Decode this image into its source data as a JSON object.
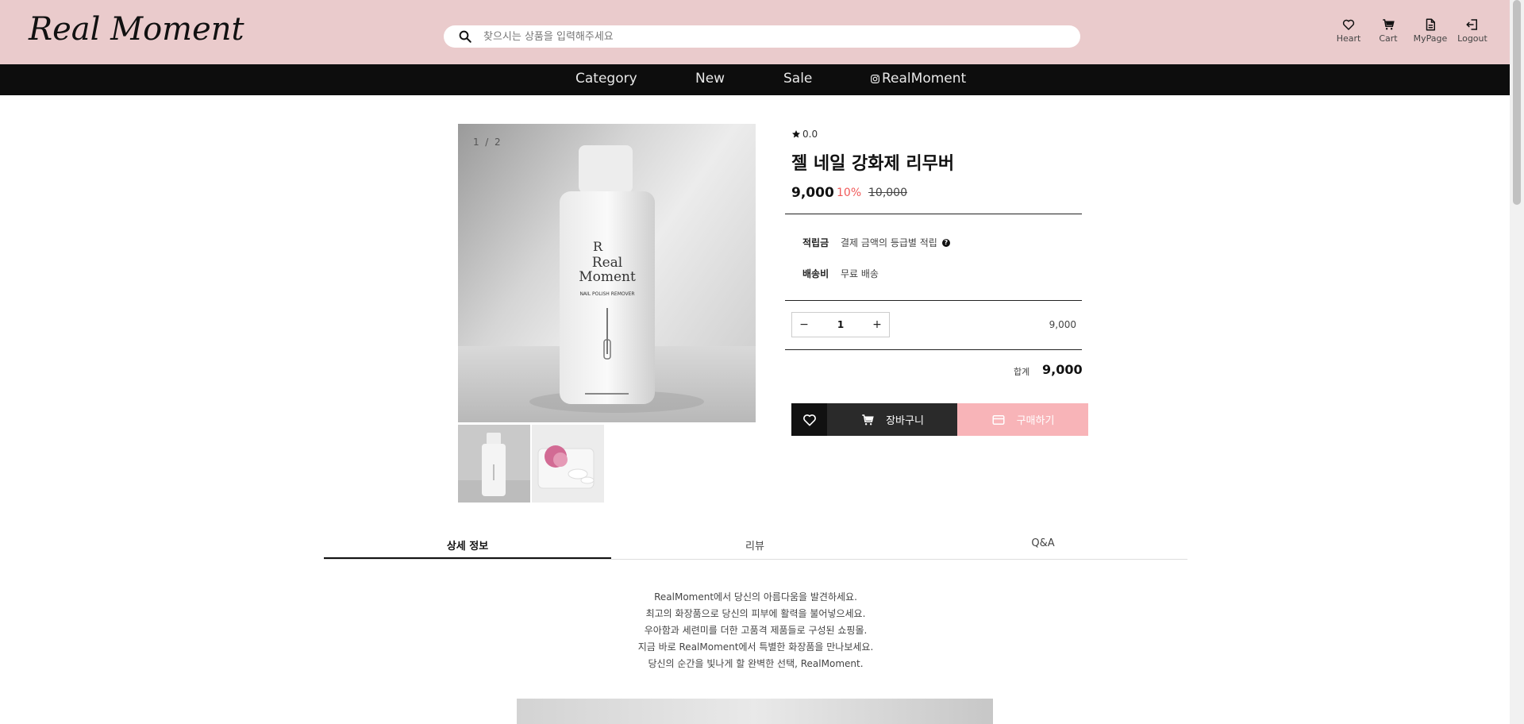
{
  "brand": {
    "logo": "Real Moment"
  },
  "search": {
    "placeholder": "찾으시는 상품을 입력해주세요"
  },
  "utility": [
    {
      "label": "Heart",
      "icon": "heart-icon"
    },
    {
      "label": "Cart",
      "icon": "cart-icon"
    },
    {
      "label": "MyPage",
      "icon": "document-icon"
    },
    {
      "label": "Logout",
      "icon": "logout-icon"
    }
  ],
  "nav": [
    {
      "label": "Category"
    },
    {
      "label": "New"
    },
    {
      "label": "Sale"
    },
    {
      "label": "RealMoment",
      "icon": "instagram-icon"
    }
  ],
  "gallery": {
    "counter_current": "1",
    "counter_sep": "/",
    "counter_total": "2"
  },
  "product": {
    "rating": "0.0",
    "title": "젤 네일 강화제 리무버",
    "price": "9,000",
    "discount": "10%",
    "original_price": "10,000",
    "points_label": "적립금",
    "points_value": "결제 금액의 등급별 적립",
    "shipping_label": "배송비",
    "shipping_value": "무료 배송",
    "quantity": "1",
    "line_total": "9,000",
    "sum_label": "합계",
    "sum_value": "9,000",
    "cart_label": "장바구니",
    "buy_label": "구매하기"
  },
  "tabs": [
    {
      "label": "상세 정보"
    },
    {
      "label": "리뷰"
    },
    {
      "label": "Q&A"
    }
  ],
  "description": [
    "RealMoment에서 당신의 아름다움을 발견하세요.",
    "최고의 화장품으로 당신의 피부에 활력을 불어넣으세요.",
    "우아함과 세련미를 더한 고품격 제품들로 구성된 쇼핑몰.",
    "지금 바로 RealMoment에서 특별한 화장품을 만나보세요.",
    "당신의 순간을 빛나게 할 완벽한 선택, RealMoment."
  ],
  "colors": {
    "header_bg": "#eacbcc",
    "nav_bg": "#0d0d0d",
    "discount": "#f05a5a",
    "buy_button": "#f8b4b8",
    "cart_button": "#2a2a2a"
  },
  "bottle_label": {
    "line1": "Real",
    "line2": "Moment",
    "product": "NAIL POLISH REMOVER"
  }
}
